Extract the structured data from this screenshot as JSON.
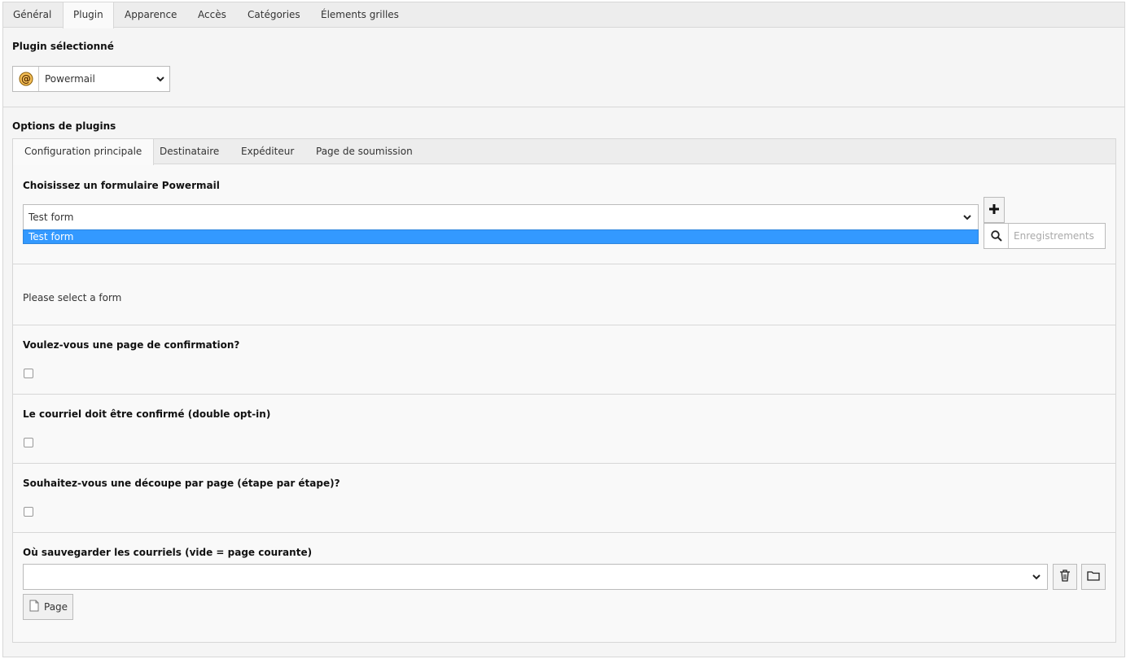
{
  "top_tabs": [
    "Général",
    "Plugin",
    "Apparence",
    "Accès",
    "Catégories",
    "Élements grilles"
  ],
  "active_top_tab": "Plugin",
  "plugin_section": {
    "title": "Plugin sélectionné",
    "selected_plugin": "Powermail",
    "plugin_icon": "powermail-at-icon"
  },
  "options_section": {
    "title": "Options de plugins",
    "tabs": [
      "Configuration principale",
      "Destinataire",
      "Expéditeur",
      "Page de soumission"
    ],
    "active_tab": "Configuration principale"
  },
  "form_field": {
    "label": "Choisissez un formulaire Powermail",
    "selected_value": "Test form",
    "dropdown_options": [
      "Test form"
    ],
    "search_placeholder": "Enregistrements"
  },
  "info_text": "Please select a form",
  "checkbox_fields": [
    {
      "label": "Voulez-vous une page de confirmation?",
      "checked": false
    },
    {
      "label": "Le courriel doit être confirmé (double opt-in)",
      "checked": false
    },
    {
      "label": "Souhaitez-vous une découpe par page (étape par étape)?",
      "checked": false
    }
  ],
  "storage_field": {
    "label": "Où sauvegarder les courriels (vide = page courante)",
    "selected_value": "",
    "page_button_label": "Page"
  },
  "colors": {
    "dropdown_highlight": "#3399ff",
    "tab_bar": "#ededed",
    "panel_bg": "#f5f5f5"
  }
}
